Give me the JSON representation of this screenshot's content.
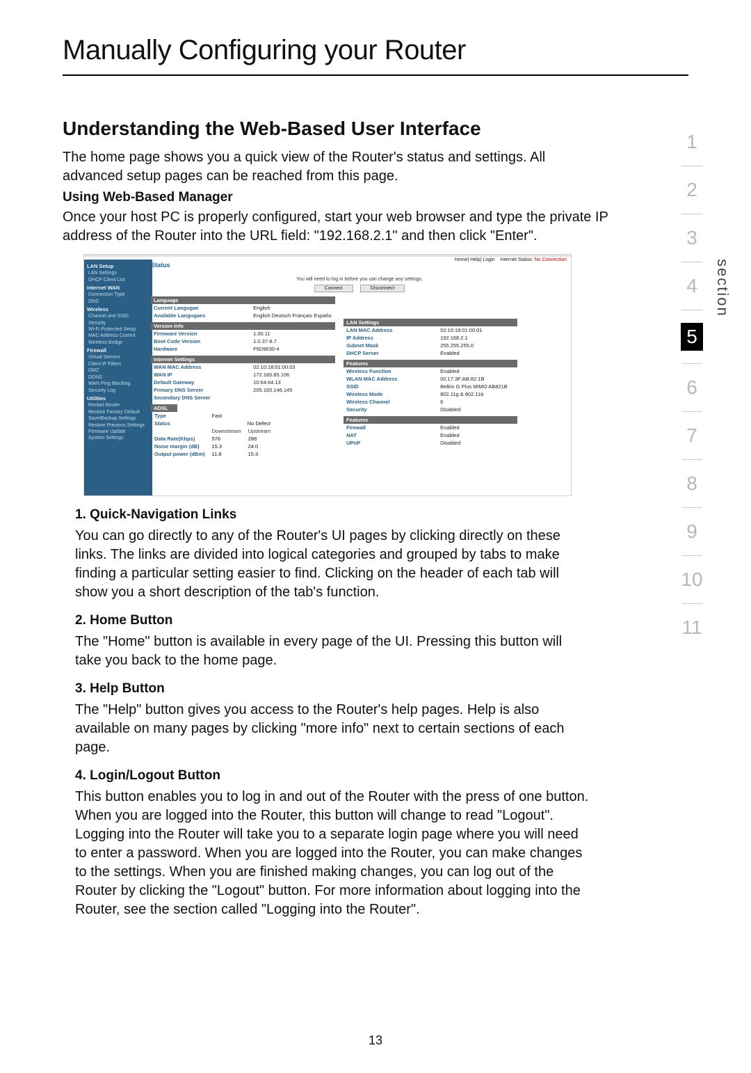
{
  "page_number": "13",
  "section_label": "section",
  "section_numbers": [
    "1",
    "2",
    "3",
    "4",
    "5",
    "6",
    "7",
    "8",
    "9",
    "10",
    "11"
  ],
  "active_section": "5",
  "title": "Manually Configuring your Router",
  "subtitle": "Understanding the Web-Based User Interface",
  "intro": "The home page shows you a quick view of the Router's status and settings. All advanced setup pages can be reached from this page.",
  "using_h": "Using Web-Based Manager",
  "using_p": "Once your host PC is properly configured, start your web browser and type the private IP address of the Router into the URL field: \"192.168.2.1\" and then click \"Enter\".",
  "item1_h": "1.   Quick-Navigation Links",
  "item1_p": "You can go directly to any of the Router's UI pages by clicking directly on these links. The links are divided into logical categories and grouped by tabs to make finding a particular setting easier to find. Clicking on the header of each tab will show you a short description of the tab's function.",
  "item2_h": "2.   Home Button",
  "item2_p": "The \"Home\" button is available in every page of the UI. Pressing this button will take you back to the home page.",
  "item3_h": "3.   Help Button",
  "item3_p": "The \"Help\" button gives you access to the Router's help pages. Help is also available on many pages by clicking \"more info\" next to certain sections of each page.",
  "item4_h": "4.   Login/Logout Button",
  "item4_p": "This button enables you to log in and out of the Router with the press of one button. When you are logged into the Router, this button will change to read \"Logout\". Logging into the Router will take you to a separate login page where you will need to enter a password. When you are logged into the Router, you can make changes to the settings. When you are finished making changes, you can log out of the Router by clicking the \"Logout\" button. For more information about logging into the Router, see the section called \"Logging into the Router\".",
  "shot": {
    "topbar_left": "Home| Help| Login",
    "topbar_status_label": "Internet Status:",
    "topbar_status_value": "No Connection",
    "sidebar": {
      "lan_setup": "LAN Setup",
      "lan_sub": [
        "LAN Settings",
        "DHCP Client List"
      ],
      "internet_wan": "Internet WAN",
      "wan_sub": [
        "Connection Type",
        "DNS"
      ],
      "wireless": "Wireless",
      "wireless_sub": [
        "Channel and SSID",
        "Security",
        "Wi-Fi Protected Setup",
        "MAC Address Control",
        "Wireless Bridge"
      ],
      "firewall": "Firewall",
      "firewall_sub": [
        "Virtual Servers",
        "Client IP Filters",
        "DMZ",
        "DDNS",
        "WAN Ping Blocking",
        "Security Log"
      ],
      "utilities": "Utilities",
      "util_sub": [
        "Restart Router",
        "Restore Factory Default",
        "Save/Backup Settings",
        "Restore Previous Settings",
        "Firmware Update",
        "System Settings"
      ]
    },
    "status": "Status",
    "note": "You will need to log in before you can change any settings.",
    "btn_connect": "Connect",
    "btn_disconnect": "Disconnect",
    "language_h": "Language",
    "language": {
      "cur_k": "Current Langugae",
      "cur_v": "English",
      "avail_k": "Available Langugaes",
      "avail_v": "English Deutsch Français Españo"
    },
    "version_h": "Version Info",
    "version": {
      "fw_k": "Firmware Version",
      "fw_v": "1.00.11",
      "bc_k": "Boot Code Version",
      "bc_v": "1.0.37-8.7",
      "hw_k": "Hardware",
      "hw_v": "F5D9630-4"
    },
    "internet_h": "Internet Settings",
    "internet": {
      "wmac_k": "WAN MAC Address",
      "wmac_v": "02:10:18:01:00:03",
      "wip_k": "WAN IP",
      "wip_v": "172.183.85.106",
      "gw_k": "Default Gateway",
      "gw_v": "10.64.64.13",
      "pdns_k": "Primary DNS Server",
      "pdns_v": "205.183.146.145",
      "sdns_k": "Secondary DNS Server",
      "sdns_v": ""
    },
    "adsl_h": "ADSL",
    "adsl": {
      "type_k": "Type",
      "type_v": "Fast",
      "status_k": "Status",
      "status_v": "No Defect",
      "col_down": "Downstream",
      "col_up": "Upstream",
      "rate_k": "Data Rate(Kbps)",
      "rate_d": "576",
      "rate_u": "288",
      "noise_k": "Noise margin (dB)",
      "noise_d": "15.3",
      "noise_u": "24.0",
      "power_k": "Output power (dBm)",
      "power_d": "11.8",
      "power_u": "15.3"
    },
    "lan_h": "LAN Settings",
    "lan": {
      "mac_k": "LAN MAC Address",
      "mac_v": "02:10:18:01:00:01",
      "ip_k": "IP Address",
      "ip_v": "192.168.2.1",
      "mask_k": "Subnet Mask",
      "mask_v": "255.255.255.0",
      "dhcp_k": "DHCP Server",
      "dhcp_v": "Enabled"
    },
    "features_h": "Features",
    "features": {
      "wf_k": "Wireless Function",
      "wf_v": "Enabled",
      "wmac_k": "WLAN MAC Address",
      "wmac_v": "00:17:3F:AB:82:1B",
      "ssid_k": "SSID",
      "ssid_v": "Belkin G Plus MIMO AB821B",
      "mode_k": "Wireless Mode",
      "mode_v": "802.11g & 802.11b",
      "ch_k": "Wireless Channel",
      "ch_v": "6",
      "sec_k": "Security",
      "sec_v": "Disabled"
    },
    "features2_h": "Features",
    "features2": {
      "fw_k": "Firewall",
      "fw_v": "Enabled",
      "nat_k": "NAT",
      "nat_v": "Enabled",
      "upnp_k": "UPnP",
      "upnp_v": "Disabled"
    }
  }
}
